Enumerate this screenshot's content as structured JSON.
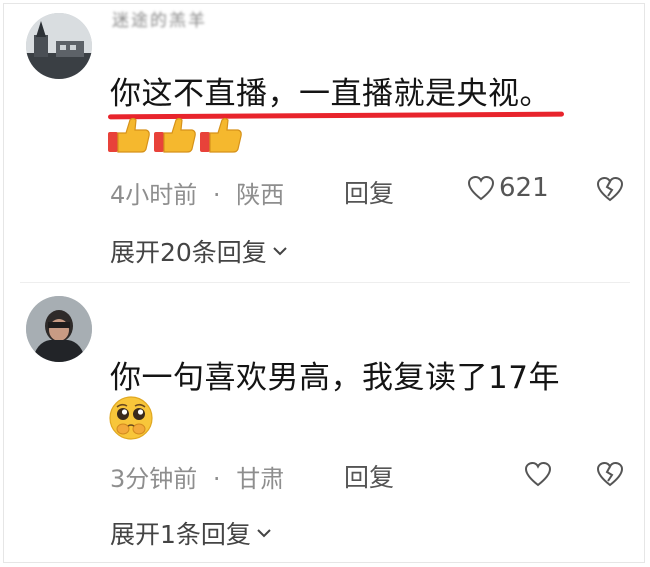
{
  "comments": [
    {
      "username": "迷途的羔羊",
      "text": "你这不直播，一直播就是央视。",
      "emoji_row": [
        "thumbs-up",
        "thumbs-up",
        "thumbs-up"
      ],
      "time": "4小时前",
      "separator": "·",
      "location": "陕西",
      "reply_label": "回复",
      "like_count": "621",
      "expand_label": "展开20条回复"
    },
    {
      "username": "",
      "text": "你一句喜欢男高，我复读了17年",
      "emoji_row": [
        "pleading-face"
      ],
      "time": "3分钟前",
      "separator": "·",
      "location": "甘肃",
      "reply_label": "回复",
      "expand_label": "展开1条回复"
    }
  ],
  "icons": {
    "like": "heart-outline-icon",
    "dislike": "broken-heart-icon",
    "expand": "chevron-down-icon"
  },
  "colors": {
    "highlight_line": "#e8242c",
    "meta_text": "#8e8e8e",
    "main_text": "#141414"
  }
}
